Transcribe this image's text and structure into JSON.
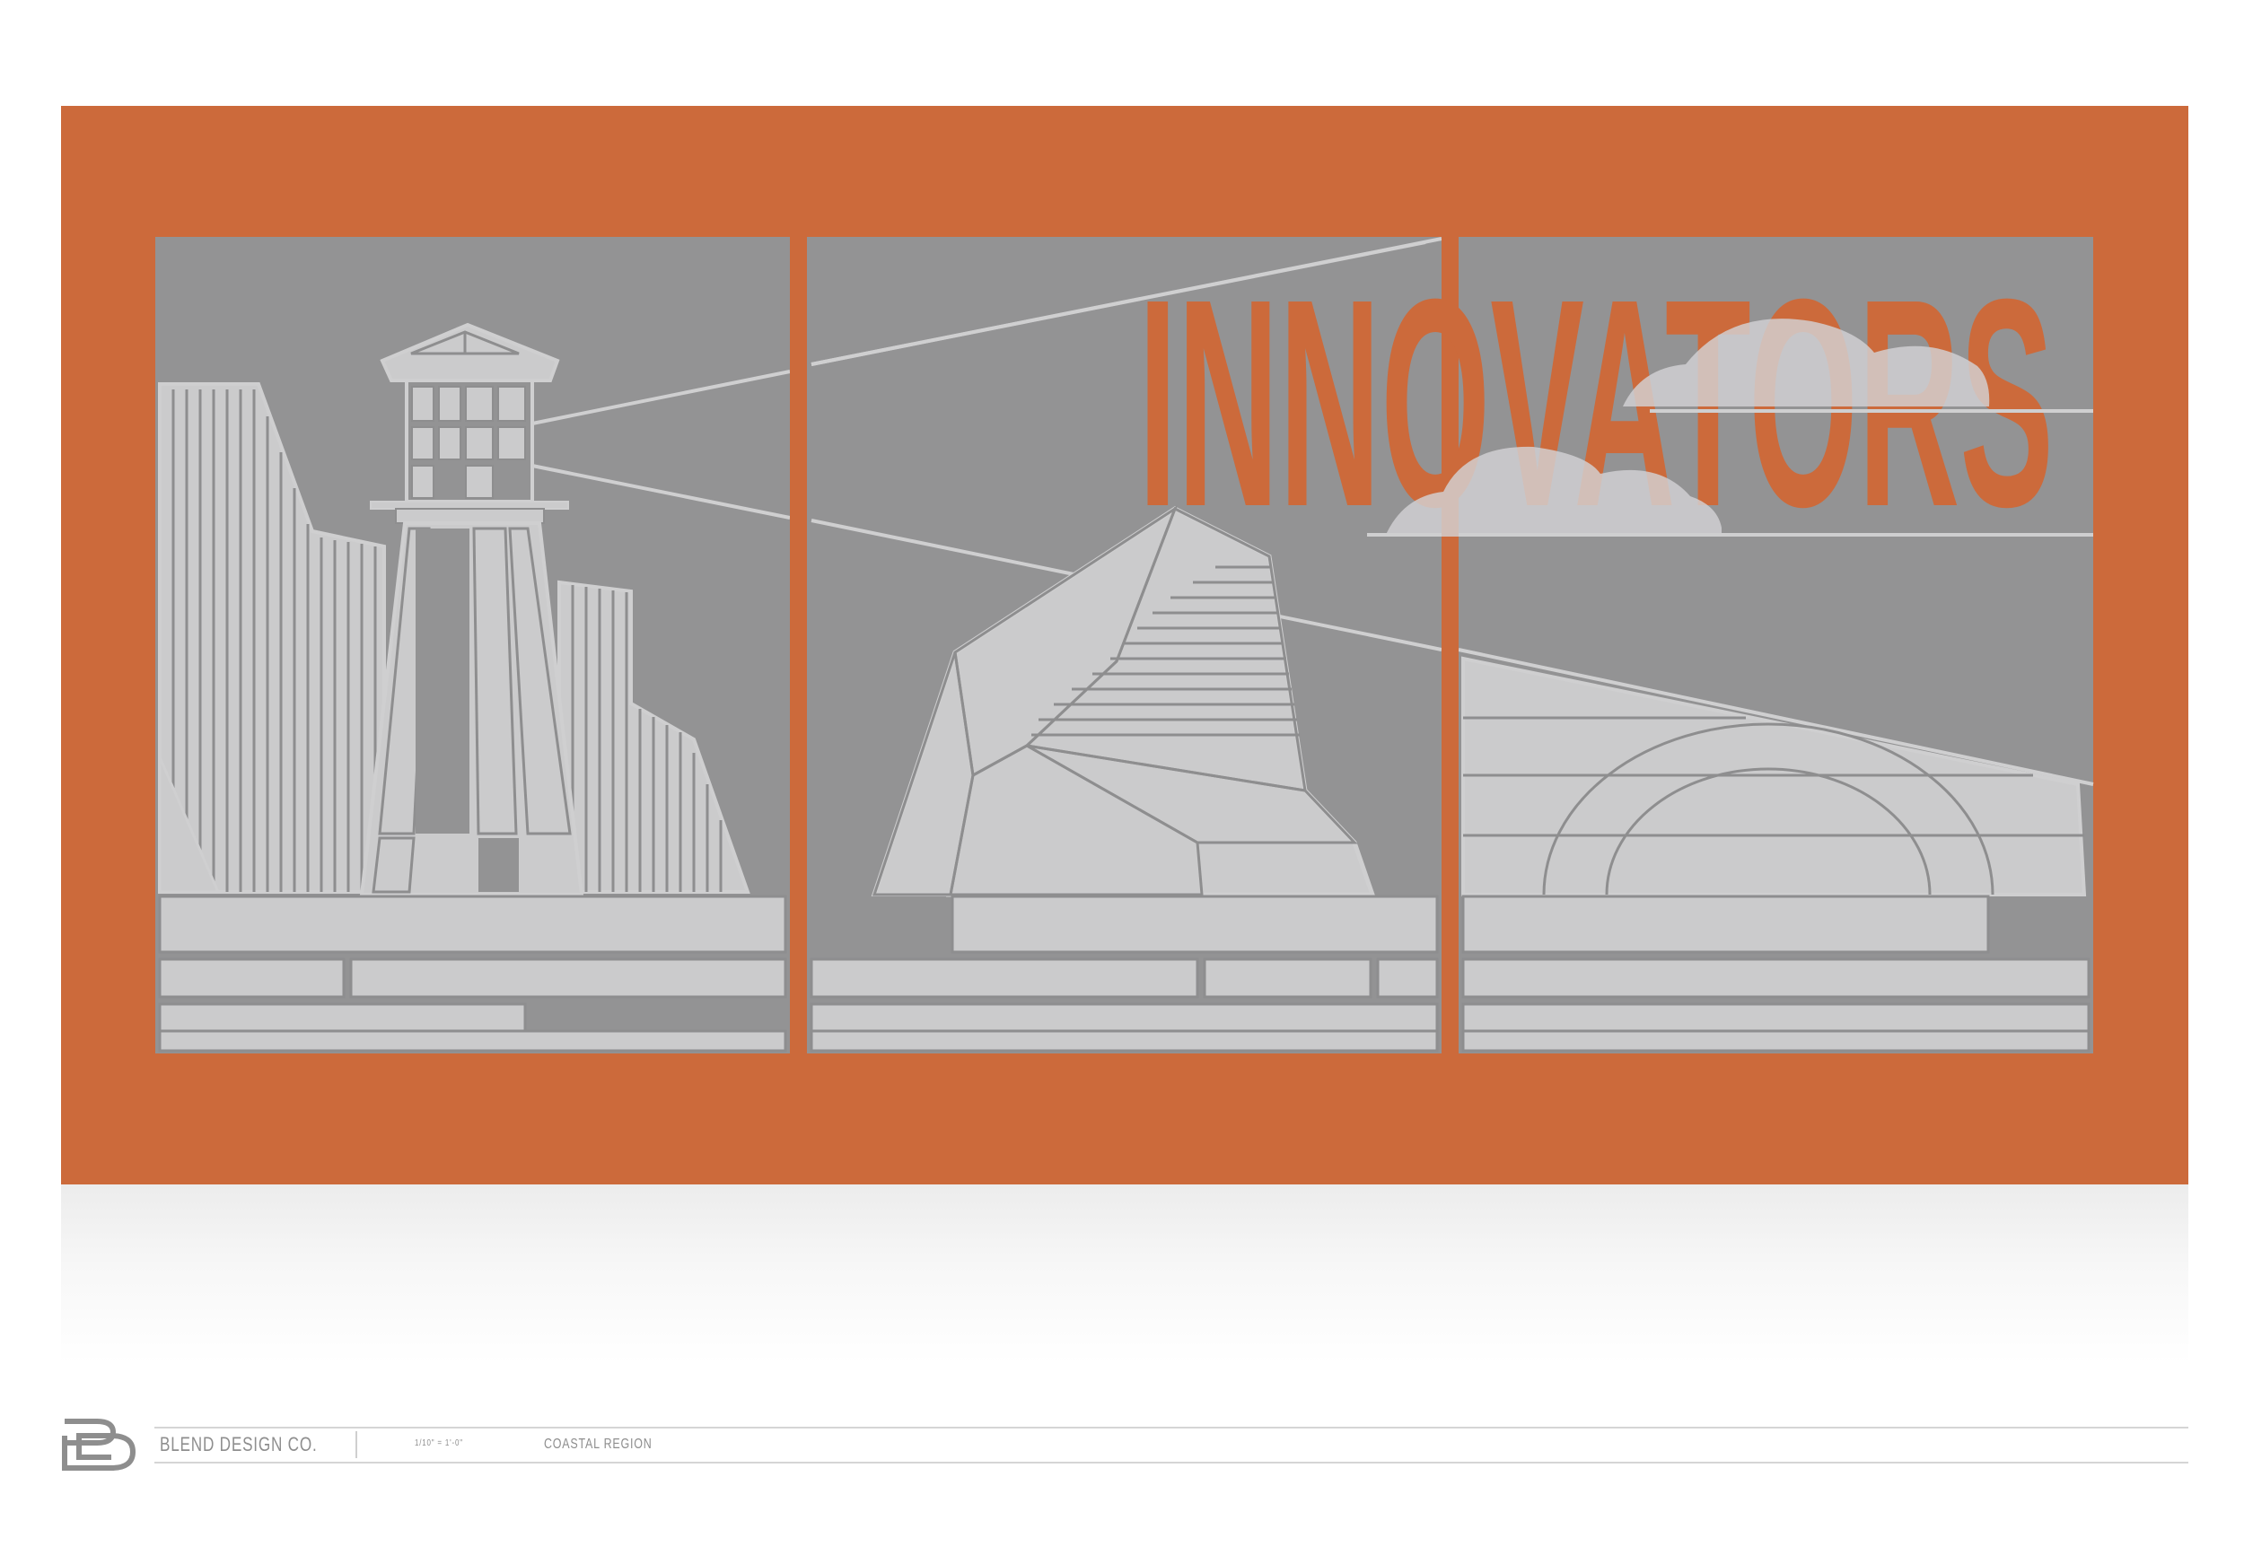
{
  "artwork": {
    "headline": "INNOVATORS",
    "colors": {
      "background": "#cc6a3b",
      "sky": "#939394",
      "structure_fill": "#cbcbcc",
      "line": "#cfcfd0",
      "outline": "#8a8a8b",
      "cloud": "#d3d2d4"
    },
    "panels": [
      {
        "scene": "lighthouse-and-cliffs"
      },
      {
        "scene": "angular-rock-building"
      },
      {
        "scene": "arched-bridge-with-clouds"
      }
    ]
  },
  "footer": {
    "logo_icon": "bd-monogram-icon",
    "brand": "BLEND DESIGN CO.",
    "scale": "1/10\" = 1'-0\"",
    "region": "COASTAL REGION"
  }
}
